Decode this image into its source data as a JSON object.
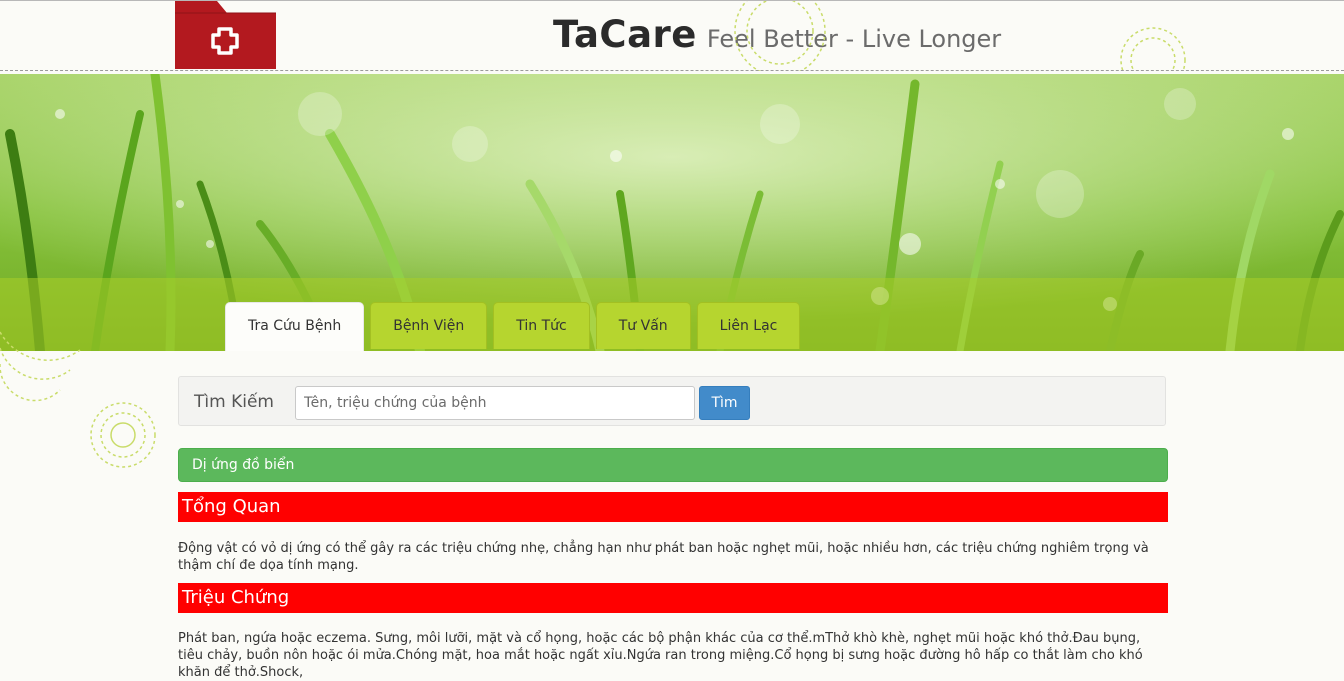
{
  "header": {
    "brand_name": "TaCare",
    "tagline": "Feel Better - Live Longer"
  },
  "nav": {
    "tabs": [
      {
        "label": "Tra Cứu Bệnh",
        "active": true
      },
      {
        "label": "Bệnh Viện",
        "active": false
      },
      {
        "label": "Tin Tức",
        "active": false
      },
      {
        "label": "Tư Vấn",
        "active": false
      },
      {
        "label": "Liên Lạc",
        "active": false
      }
    ]
  },
  "search": {
    "label": "Tìm Kiếm",
    "placeholder": "Tên, triệu chứng của bệnh",
    "button_label": "Tìm"
  },
  "result": {
    "title": "Dị ứng đồ biển",
    "sections": [
      {
        "heading": "Tổng Quan",
        "text": "Động vật có vỏ dị ứng có thể gây ra các triệu chứng nhẹ, chẳng hạn như phát ban hoặc nghẹt mũi, hoặc nhiều hơn, các triệu chứng nghiêm trọng và thậm chí đe dọa tính mạng."
      },
      {
        "heading": "Triệu Chứng",
        "text": "Phát ban, ngứa hoặc eczema. Sưng, môi lưỡi, mặt và cổ họng, hoặc các bộ phận khác của cơ thể.mThở khò khè, nghẹt mũi hoặc khó thở.Đau bụng, tiêu chảy, buồn nôn hoặc ói mửa.Chóng mặt, hoa mắt hoặc ngất xỉu.Ngứa ran trong miệng.Cổ họng bị sưng hoặc đường hô hấp co thắt làm cho khó khăn để thở.Shock,"
      }
    ]
  },
  "colors": {
    "tab_green": "#b6d52f",
    "section_red": "#ff0000",
    "result_green": "#5cb85c",
    "button_blue": "#428bca",
    "logo_red": "#b3191f"
  }
}
